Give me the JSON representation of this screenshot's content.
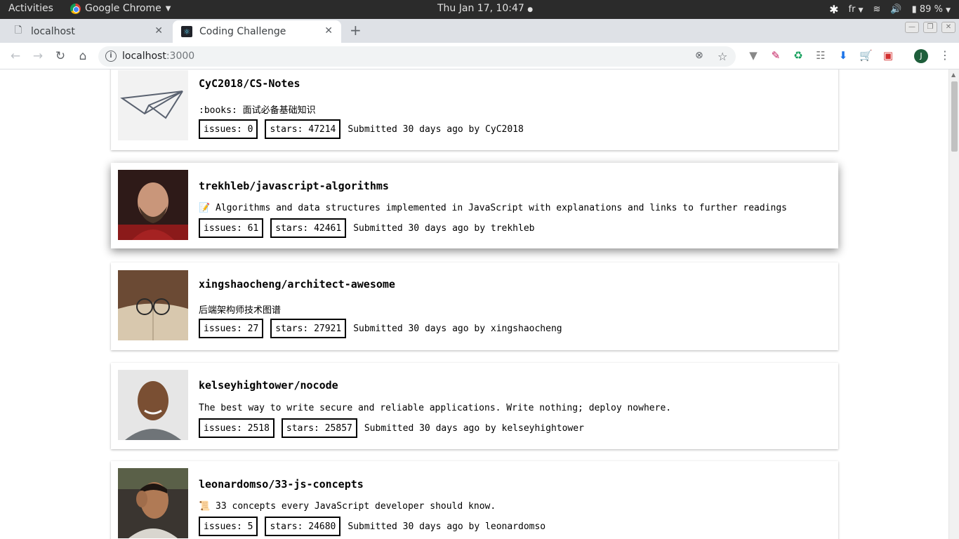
{
  "system_bar": {
    "activities": "Activities",
    "app_name": "Google Chrome",
    "clock": "Thu Jan 17, 10:47",
    "input_lang": "fr",
    "battery": "89 %"
  },
  "tabs": [
    {
      "title": "localhost"
    },
    {
      "title": "Coding Challenge"
    }
  ],
  "omnibox": {
    "host": "localhost",
    "port": ":3000"
  },
  "profile_initial": "J",
  "repos": [
    {
      "name": "CyC2018/CS-Notes",
      "description": ":books: 面试必备基础知识",
      "issues": "issues: 0",
      "stars": "stars: 47214",
      "submitted": "Submitted 30 days ago by CyC2018"
    },
    {
      "name": "trekhleb/javascript-algorithms",
      "description": "📝 Algorithms and data structures implemented in JavaScript with explanations and links to further readings",
      "issues": "issues: 61",
      "stars": "stars: 42461",
      "submitted": "Submitted 30 days ago by trekhleb"
    },
    {
      "name": "xingshaocheng/architect-awesome",
      "description": "后端架构师技术图谱",
      "issues": "issues: 27",
      "stars": "stars: 27921",
      "submitted": "Submitted 30 days ago by xingshaocheng"
    },
    {
      "name": "kelseyhightower/nocode",
      "description": "The best way to write secure and reliable applications. Write nothing; deploy nowhere.",
      "issues": "issues: 2518",
      "stars": "stars: 25857",
      "submitted": "Submitted 30 days ago by kelseyhightower"
    },
    {
      "name": "leonardomso/33-js-concepts",
      "description": "📜 33 concepts every JavaScript developer should know.",
      "issues": "issues: 5",
      "stars": "stars: 24680",
      "submitted": "Submitted 30 days ago by leonardomso"
    }
  ]
}
